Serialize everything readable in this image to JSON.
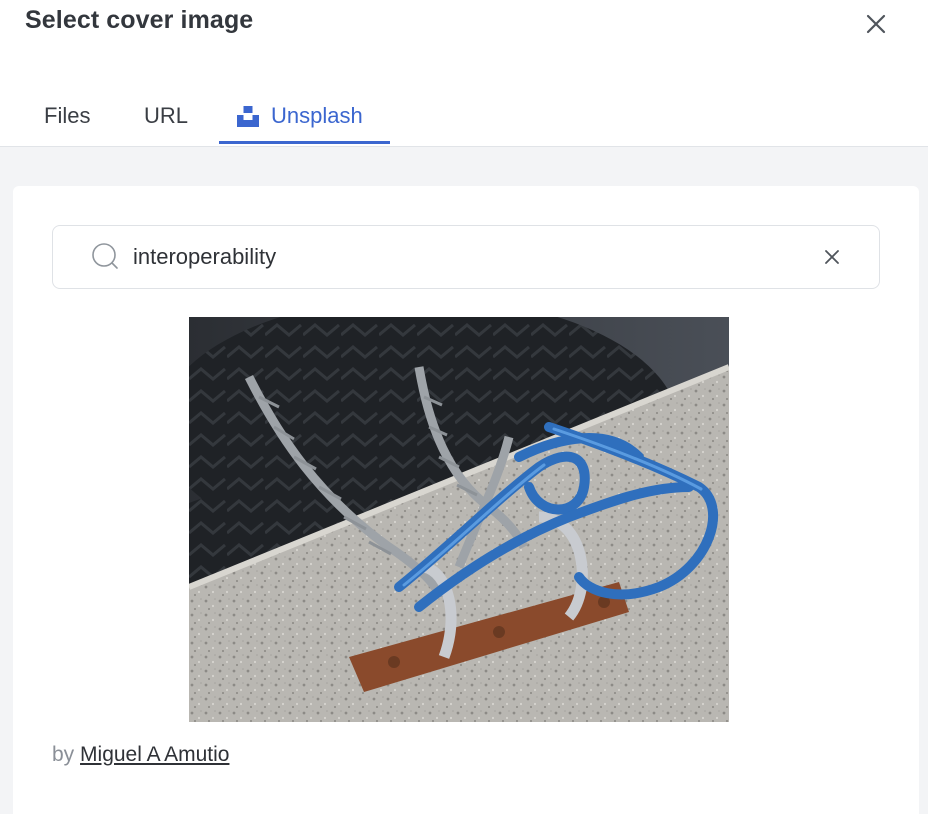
{
  "dialog": {
    "title": "Select cover image"
  },
  "tabs": [
    {
      "label": "Files",
      "active": false
    },
    {
      "label": "URL",
      "active": false
    },
    {
      "label": "Unsplash",
      "active": true,
      "icon": "unsplash-icon"
    }
  ],
  "search": {
    "value": "interoperability",
    "icon": "search-icon",
    "clear_icon": "clear-icon"
  },
  "result": {
    "image_alt": "chains and blue rope tied to rusty metal bracket on concrete next to tires",
    "credit_prefix": "by",
    "author": "Miguel A Amutio"
  },
  "colors": {
    "accent": "#3b66cf",
    "background": "#f3f4f6",
    "text": "#33373d",
    "muted": "#8a8f97"
  }
}
